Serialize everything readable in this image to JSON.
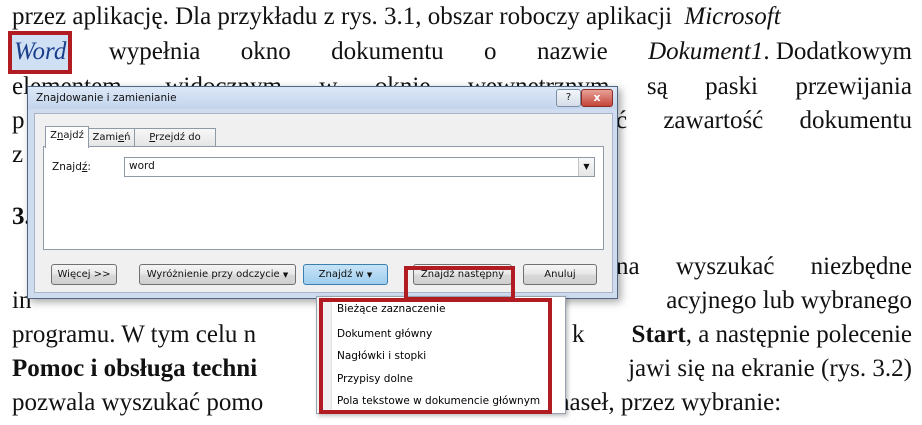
{
  "document": {
    "line1": {
      "a": "przez aplikację. Dla przykładu z rys. 3.1, obszar roboczy aplikacji",
      "b": "Microsoft"
    },
    "line2": {
      "highlight": "Word",
      "a": "wypełnia",
      "b": "okno",
      "c": "dokumentu",
      "d": "o",
      "e": "nazwie",
      "f": "Dokument1",
      "g": ". Dodatkowym"
    },
    "line3": {
      "a": "elementem,",
      "b": "widocznym",
      "c": "w",
      "d": "oknie",
      "e": "wewnętrznym",
      "f": "są",
      "g": "paski",
      "h": "przewijania"
    },
    "line4": {
      "a": "p",
      "b": "ć",
      "c": "zawartość",
      "d": "dokumentu"
    },
    "line5": {
      "a": "z"
    },
    "line6": {
      "a": "3."
    },
    "line7": {
      "a": "na",
      "b": "wyszukać",
      "c": "niezbędne"
    },
    "line8": {
      "a": "in",
      "b": "acyjnego lub wybranego"
    },
    "line9": {
      "a": "programu. W tym celu n",
      "b": "k",
      "c": "Start",
      "d": ", a następnie polecenie"
    },
    "line10": {
      "a": "Pomoc i obsługa techni",
      "b": "jawi się na ekranie (rys. 3.2)"
    },
    "line11": {
      "a": "pozwala wyszukać pomo",
      "b": "haseł, przez wybranie:"
    }
  },
  "dialog": {
    "title": "Znajdowanie i zamienianie",
    "help_label": "?",
    "close_label": "x",
    "tabs": [
      {
        "pre": "Z",
        "ul": "n",
        "post": "ajdź"
      },
      {
        "pre": "Zami",
        "ul": "e",
        "post": "ń"
      },
      {
        "pre": "",
        "ul": "P",
        "post": "rzejdź do"
      }
    ],
    "find_label": {
      "pre": "Znajd",
      "ul": "ź",
      "post": ":"
    },
    "find_value": "word",
    "buttons": {
      "more": "Więcej >>",
      "reading_highlight": "Wyróżnienie przy odczycie",
      "find_in": "Znajdź w",
      "find_next": "Znajdź następny",
      "cancel": "Anuluj"
    }
  },
  "menu": {
    "items": [
      "Bieżące zaznaczenie",
      "Dokument główny",
      "Nagłówki i stopki",
      "Przypisy dolne",
      "Pola tekstowe w dokumencie głównym"
    ]
  },
  "colors": {
    "annotation_red": "#b01c22",
    "highlight_blue": "#cfe0f5"
  }
}
